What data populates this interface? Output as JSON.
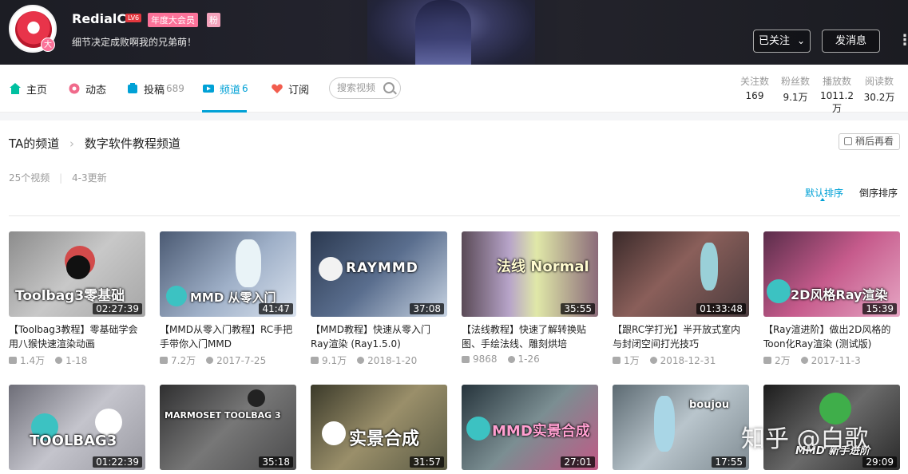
{
  "profile": {
    "username": "RedialC",
    "level": "LV6",
    "vip_badge": "年度大会员",
    "fan_badge": "粉",
    "avatar_badge": "大",
    "signature": "细节决定成败啊我的兄弟萌！",
    "follow_button": "已关注",
    "message_button": "发消息",
    "more_button": "⋮"
  },
  "nav": {
    "items": [
      {
        "label": "主页",
        "count": "",
        "icon": "home-icon",
        "color": "#00c0a0"
      },
      {
        "label": "动态",
        "count": "",
        "icon": "dynamic-icon",
        "color": "#f06a8b"
      },
      {
        "label": "投稿",
        "count": "689",
        "icon": "upload-icon",
        "color": "#00a1d6"
      },
      {
        "label": "频道",
        "count": "6",
        "icon": "channel-icon",
        "color": "#00a1d6"
      },
      {
        "label": "订阅",
        "count": "",
        "icon": "heart-icon",
        "color": "#f25d4e"
      }
    ],
    "active": "频道",
    "search_placeholder": "搜索视频"
  },
  "stats": [
    {
      "label": "关注数",
      "value": "169"
    },
    {
      "label": "粉丝数",
      "value": "9.1万"
    },
    {
      "label": "播放数",
      "value": "1011.2万"
    },
    {
      "label": "阅读数",
      "value": "30.2万"
    }
  ],
  "channel": {
    "crumb_root": "TA的频道",
    "crumb_arrow": "›",
    "name": "数字软件教程频道",
    "watch_later": "稍后再看",
    "video_count": "25个视频",
    "updated": "4-3更新",
    "sort_default": "默认排序",
    "sort_reverse": "倒序排序"
  },
  "videos": [
    {
      "title": "【Toolbag3教程】零基础学会用八猴快速渲染动画",
      "duration": "02:27:39",
      "plays": "1.4万",
      "date": "1-18",
      "caption": "Toolbag3零基础",
      "bg": "linear-gradient(135deg,#8c8c8c,#c8c8c8 50%,#a6a6a6)"
    },
    {
      "title": "【MMD从零入门教程】RC手把手带你入门MMD",
      "duration": "41:47",
      "plays": "7.2万",
      "date": "2017-7-25",
      "caption": "MMD 从零入门",
      "bg": "linear-gradient(135deg,#4b5a73,#9fb0c8 55%,#d9e2ee)"
    },
    {
      "title": "【MMD教程】快速从零入门Ray渲染 (Ray1.5.0)",
      "duration": "37:08",
      "plays": "9.1万",
      "date": "2018-1-20",
      "caption": "RAYMMD",
      "bg": "linear-gradient(135deg,#2b3950,#5a6e8e 50%,#c7d3e2)"
    },
    {
      "title": "【法线教程】快速了解转换贴图、手绘法线、雕刻烘培",
      "duration": "35:55",
      "plays": "9868",
      "date": "1-26",
      "caption": "法线 Normal",
      "bg": "linear-gradient(90deg,#5a4a56,#b7a4c9 35%,#e0e8a8 55%,#8b6b7a)"
    },
    {
      "title": "【跟RC学打光】半开放式室内与封闭空间打光技巧",
      "duration": "01:33:48",
      "plays": "1万",
      "date": "2018-12-31",
      "caption": "",
      "bg": "linear-gradient(135deg,#3a2a2a,#8a5f5a 45%,#4a3b3d)"
    },
    {
      "title": "【Ray渲进阶】做出2D风格的Toon化Ray渲染 (测试版)",
      "duration": "15:39",
      "plays": "2万",
      "date": "2017-11-3",
      "caption": "2D风格Ray渲染",
      "bg": "linear-gradient(135deg,#5a2d4a,#c65b8c 50%,#e6a6c4)"
    },
    {
      "title": "",
      "duration": "01:22:39",
      "plays": "",
      "date": "",
      "caption": "TOOLBAG3",
      "bg": "linear-gradient(135deg,#6e6e78,#c4c4cc 50%,#9a9aa2)"
    },
    {
      "title": "",
      "duration": "35:18",
      "plays": "",
      "date": "",
      "caption": "MARMOSET TOOLBAG 3",
      "bg": "linear-gradient(135deg,#2f2f30,#777 50%,#4b4b4c)"
    },
    {
      "title": "",
      "duration": "31:57",
      "plays": "",
      "date": "",
      "caption": "实景合成",
      "bg": "linear-gradient(135deg,#3b3a2a,#9a8f6a 50%,#5a5a44)"
    },
    {
      "title": "",
      "duration": "27:01",
      "plays": "",
      "date": "",
      "caption": "MMD实景合成",
      "bg": "linear-gradient(135deg,#26343c,#7b8e92 50%,#c05a86)"
    },
    {
      "title": "",
      "duration": "17:55",
      "plays": "",
      "date": "",
      "caption": "boujou",
      "bg": "linear-gradient(135deg,#5c6a72,#b9c5cc 50%,#7f8b92)"
    },
    {
      "title": "",
      "duration": "29:09",
      "plays": "",
      "date": "",
      "caption": "MMD 新手进阶",
      "bg": "linear-gradient(135deg,#1c1c1c,#6a6a6a 50%,#2a2a2a)"
    }
  ],
  "watermark": "知乎 @白歌"
}
